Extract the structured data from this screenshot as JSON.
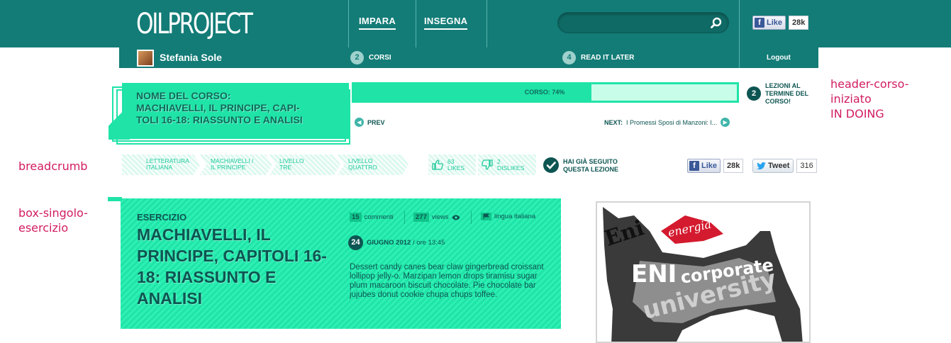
{
  "header": {
    "logo": "OILPROJECT",
    "nav": [
      {
        "label": "IMPARA"
      },
      {
        "label": "INSEGNA"
      }
    ],
    "search": {
      "placeholder": ""
    },
    "fb_like": {
      "label": "Like",
      "count": "28k"
    }
  },
  "userbar": {
    "user_name": "Stefania Sole",
    "courses": {
      "count": "2",
      "label": "CORSI"
    },
    "read_later": {
      "count": "4",
      "label": "READ IT LATER"
    },
    "logout": "Logout"
  },
  "course": {
    "title_line1": "NOME DEL CORSO:",
    "title_line2": "MACHIAVELLI, IL PRINCIPE, CAPI-",
    "title_line3": "TOLI 16-18: RIASSUNTO E ANALISI",
    "progress_label": "CORSO: 74%",
    "progress_fraction": 0.62,
    "lessons_remaining": "2",
    "lessons_label_line1": "LEZIONI AL",
    "lessons_label_line2": "TERMINE DEL",
    "lessons_label_line3": "CORSO!",
    "prev_label": "PREV",
    "next_prefix": "NEXT:",
    "next_title": "I Promessi Sposi di Manzoni: l..."
  },
  "annotations": {
    "header_line1": "header-corso-",
    "header_line2": "iniziato",
    "header_line3": "IN DOING",
    "breadcrumb": "breadcrumb",
    "box_line1": "box-singolo-",
    "box_line2": "esercizio"
  },
  "breadcrumb": {
    "items": [
      {
        "line1": "LETTERATURA",
        "line2": "ITALIANA"
      },
      {
        "line1": "MACHIAVELLI /",
        "line2": "IL PRINCIPE"
      },
      {
        "line1": "LIVELLO",
        "line2": "TRE"
      },
      {
        "line1": "LIVELLO",
        "line2": "QUATTRO"
      }
    ],
    "likes": {
      "count": "63",
      "label": "LIKES"
    },
    "dislikes": {
      "count": "2",
      "label": "DISLIKES"
    },
    "seen_line1": "HAI GIÀ SEGUITO",
    "seen_line2": "QUESTA LEZIONE",
    "fb_like": {
      "label": "Like",
      "count": "28k"
    },
    "tweet": {
      "label": "Tweet",
      "count": "316"
    }
  },
  "exercise": {
    "kicker": "ESERCIZIO",
    "title": "MACHIAVELLI, IL PRINCIPE, CAPITOLI 16-18: RIASSUNTO E ANALISI",
    "comments_count": "15",
    "comments_label": "commenti",
    "views_count": "277",
    "views_label": "views",
    "language": "lingua italiana",
    "day": "24",
    "date_month": "GIUGNO 2012",
    "date_rest": "/ ore 13:45",
    "description": "Dessert candy canes bear claw gingerbread croissant lollipop jelly-o. Marzipan lemon drops tiramisu sugar plum macaroon biscuit chocolate. Pie chocolate bar jujubes donut cookie chupa chups toffee."
  },
  "ad": {
    "word1": "Eni",
    "word2": "energia",
    "word3": "ENI",
    "word4": "corporate",
    "word5": "university"
  },
  "colors": {
    "brand_teal": "#137c77",
    "accent_mint": "#1fe3a7",
    "annotation_pink": "#d11c61"
  }
}
